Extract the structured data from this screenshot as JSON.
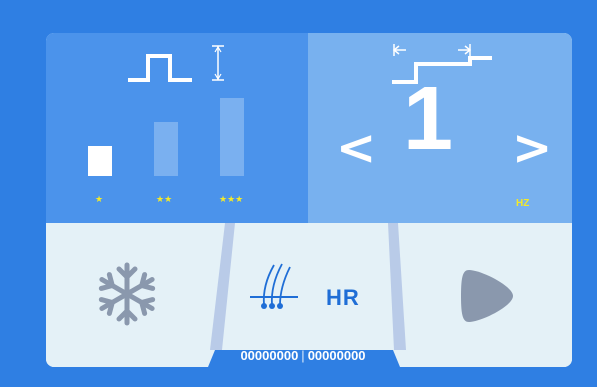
{
  "intensity": {
    "levels": [
      {
        "stars": "★",
        "fill_fraction": 0.36,
        "active": true
      },
      {
        "stars": "★★",
        "fill_fraction": 0.66,
        "active": false
      },
      {
        "stars": "★★★",
        "fill_fraction": 1.0,
        "active": false
      }
    ]
  },
  "frequency": {
    "prev_label": "<",
    "value": "1",
    "next_label": ">",
    "unit": "HZ"
  },
  "modes": {
    "hr_label": "HR"
  },
  "counter": {
    "left": "00000000",
    "separator": "|",
    "right": "00000000"
  },
  "colors": {
    "background": "#2f7fe3",
    "panel_left": "#4b93eb",
    "panel_right": "#78b1ef",
    "bottom_panel": "#e4f1f7",
    "star_yellow": "#f3e92a",
    "accent_blue": "#1f6ed6",
    "grey_icon": "#8a98ad"
  },
  "icons": {
    "pulse_height": "pulse-amplitude-icon",
    "pulse_width": "pulse-width-icon",
    "cooling": "snowflake-icon",
    "hair": "hair-follicle-icon",
    "play": "play-shape-icon"
  }
}
